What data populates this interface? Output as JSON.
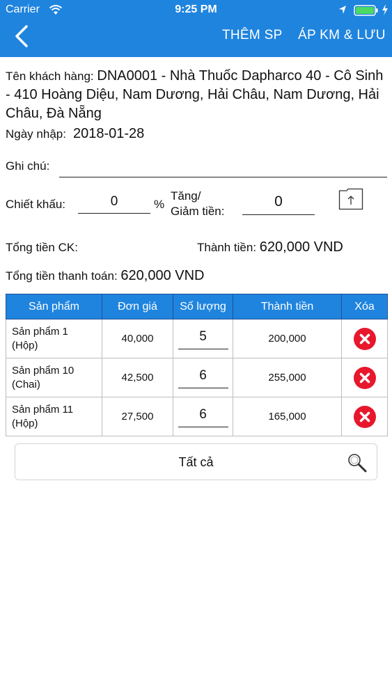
{
  "status_bar": {
    "carrier": "Carrier",
    "time": "9:25 PM"
  },
  "nav": {
    "back_icon": "chevron-left-icon",
    "add_product": "THÊM SP",
    "apply_and_save": "ÁP KM & LƯU"
  },
  "form": {
    "customer_label": "Tên khách hàng: ",
    "customer_value": "DNA0001 - Nhà Thuốc Dapharco 40 - Cô Sinh - 410 Hoàng Diệu, Nam Dương, Hải Châu, Nam Dương, Hải Châu, Đà Nẵng",
    "date_label": "Ngày nhập:",
    "date_value": "2018-01-28",
    "note_label": "Ghi chú:",
    "note_value": "",
    "discount_label": "Chiết khấu:",
    "discount_value": "0",
    "discount_unit": "%",
    "adjust_label_line1": "Tăng/",
    "adjust_label_line2": "Giảm tiền:",
    "adjust_value": "0",
    "upload_icon": "upload-icon"
  },
  "totals": {
    "ck_label": "Tổng tiền CK:",
    "amount_label": "Thành tiền: ",
    "amount_value": "620,000 VND",
    "payment_label": "Tổng tiền thanh toán: ",
    "payment_value": "620,000 VND"
  },
  "table": {
    "headers": [
      "Sản phẩm",
      "Đơn giá",
      "Số lượng",
      "Thành tiền",
      "Xóa"
    ],
    "rows": [
      {
        "name": "Sản phẩm 1",
        "unit": "(Hộp)",
        "price": "40,000",
        "qty": "5",
        "total": "200,000"
      },
      {
        "name": "Sản phẩm 10",
        "unit": "(Chai)",
        "price": "42,500",
        "qty": "6",
        "total": "255,000"
      },
      {
        "name": "Sản phẩm 11",
        "unit": "(Hộp)",
        "price": "27,500",
        "qty": "6",
        "total": "165,000"
      }
    ]
  },
  "filter": {
    "label": "Tất cả",
    "icon": "search-icon"
  },
  "colors": {
    "primary": "#1f84de",
    "delete": "#e8172c",
    "battery": "#4cd964"
  }
}
